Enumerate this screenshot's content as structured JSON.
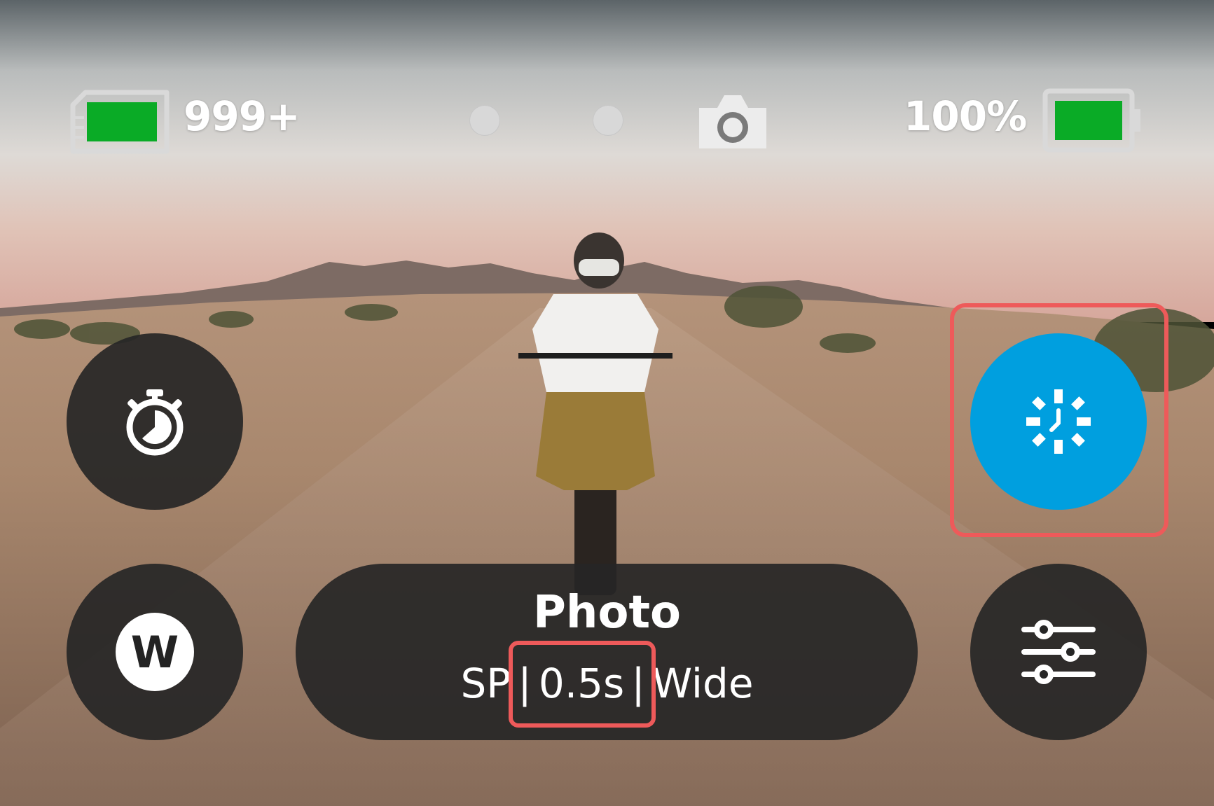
{
  "status_bar": {
    "sd_card_count": "999+",
    "battery_percent": "100%",
    "icons": [
      "sd-card-icon",
      "camera-icon",
      "battery-icon"
    ],
    "status_color": "#0aab26"
  },
  "controls": {
    "timer_icon": "stopwatch-icon",
    "lens_badge": "W",
    "capture_icon": "night-lapse-icon",
    "settings_icon": "sliders-icon",
    "capture_color": "#009fdf"
  },
  "mode": {
    "title": "Photo",
    "preset": "SP",
    "interval": "0.5s",
    "lens": "Wide",
    "separator": "|"
  },
  "annotations": {
    "highlight_color": "#ee5a5a"
  }
}
